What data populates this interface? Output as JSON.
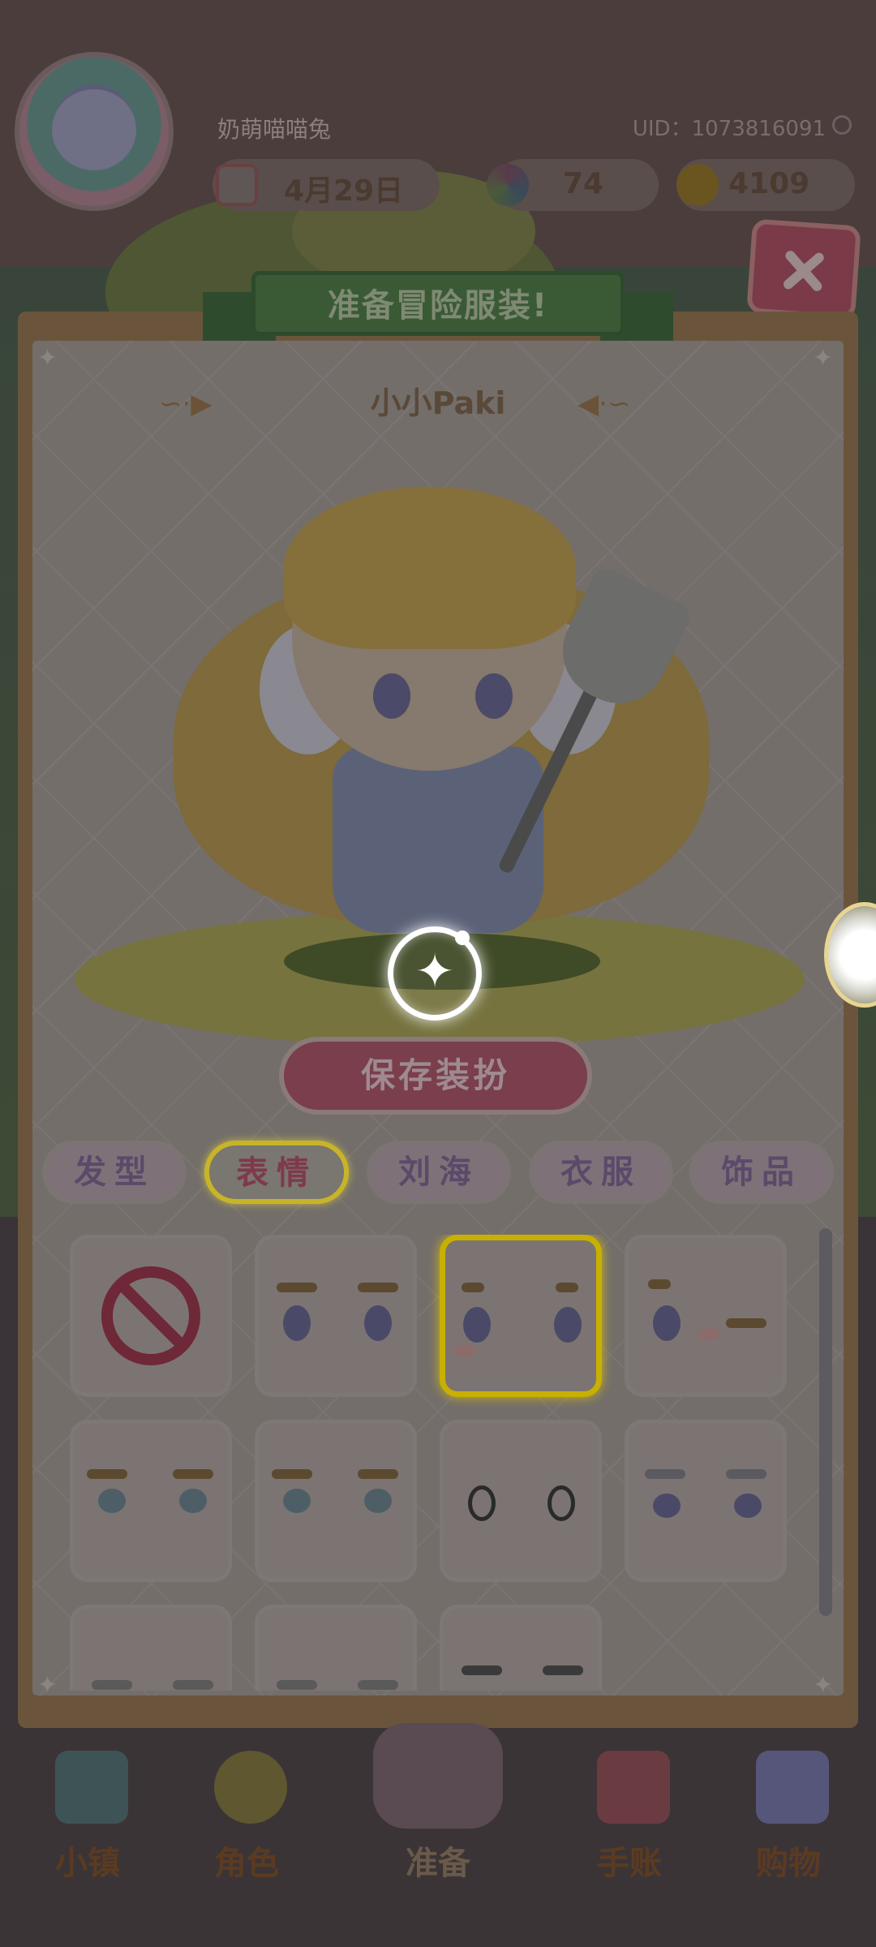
{
  "player": {
    "name": "奶萌喵喵兔",
    "uid": "UID：1073816091",
    "date": "4月29日",
    "gems": "74",
    "coins": "4109"
  },
  "dialog": {
    "title": "准备冒险服装!",
    "character_name": "小小Paki",
    "save_label": "保存装扮",
    "close_icon": "close-icon"
  },
  "tabs": [
    {
      "label": "发型",
      "active": false
    },
    {
      "label": "表情",
      "active": true
    },
    {
      "label": "刘海",
      "active": false
    },
    {
      "label": "衣服",
      "active": false
    },
    {
      "label": "饰品",
      "active": false
    }
  ],
  "expressions": [
    {
      "name": "none",
      "selected": false
    },
    {
      "name": "face-1",
      "selected": false
    },
    {
      "name": "face-2",
      "selected": true
    },
    {
      "name": "face-3-wink",
      "selected": false
    },
    {
      "name": "face-4",
      "selected": false
    },
    {
      "name": "face-5",
      "selected": false
    },
    {
      "name": "face-6-round-eyes",
      "selected": false
    },
    {
      "name": "face-7",
      "selected": false
    },
    {
      "name": "face-8",
      "selected": false
    },
    {
      "name": "face-9",
      "selected": false
    },
    {
      "name": "face-10",
      "selected": false
    }
  ],
  "nav": [
    {
      "label": "小镇",
      "icon": "map-icon"
    },
    {
      "label": "角色",
      "icon": "character-icon"
    },
    {
      "label": "准备",
      "icon": "prepare-icon"
    },
    {
      "label": "手账",
      "icon": "journal-icon"
    },
    {
      "label": "购物",
      "icon": "shopping-bag-icon"
    }
  ]
}
